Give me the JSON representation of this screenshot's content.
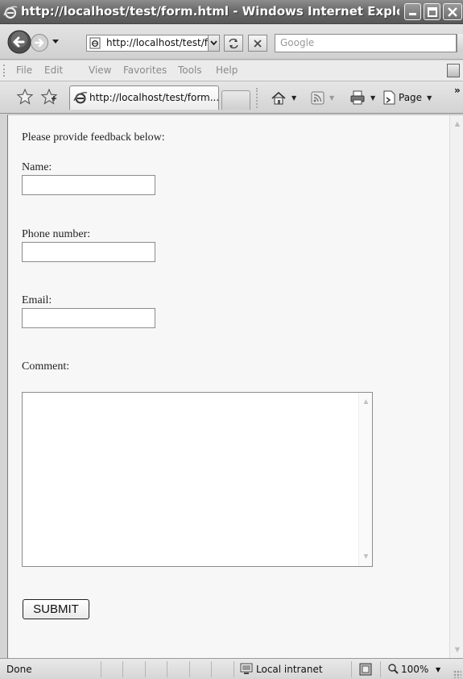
{
  "window": {
    "title": "http://localhost/test/form.html - Windows Internet Explorer pr...",
    "minimize_icon": "minimize-icon",
    "maximize_icon": "maximize-icon",
    "close_icon": "close-icon"
  },
  "address_bar": {
    "url": "http://localhost/test/f",
    "search_placeholder": "Google"
  },
  "menu": {
    "items": [
      "File",
      "Edit",
      "View",
      "Favorites",
      "Tools",
      "Help"
    ]
  },
  "tabs": [
    {
      "label": "http://localhost/test/form....",
      "active": true
    }
  ],
  "commands": {
    "page_label": "Page",
    "more": "»"
  },
  "form": {
    "intro": "Please provide feedback below:",
    "name_label": "Name:",
    "name_value": "",
    "phone_label": "Phone number:",
    "phone_value": "",
    "email_label": "Email:",
    "email_value": "",
    "comment_label": "Comment:",
    "comment_value": "",
    "submit_label": "SUBMIT"
  },
  "status": {
    "text": "Done",
    "zone": "Local intranet",
    "zoom": "100%"
  },
  "colors": {
    "titlebar": "#6a6a6a",
    "page_background": "#f7f7f7"
  }
}
